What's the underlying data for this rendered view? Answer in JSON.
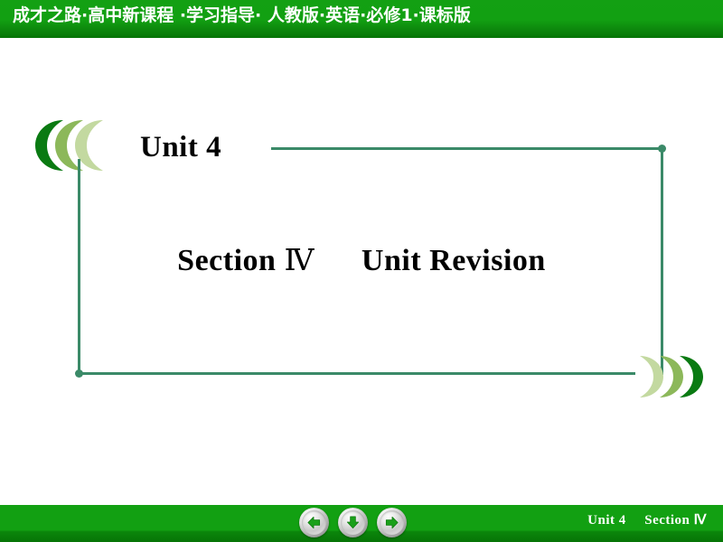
{
  "header": {
    "title": "成才之路·高中新课程 ·学习指导· 人教版·英语·必修1·课标版",
    "bg_color": "#12a012"
  },
  "slide": {
    "unit_label": "Unit 4",
    "title_prefix": "Section",
    "title_roman": "Ⅳ",
    "title_main": "Unit Revision",
    "frame_color": "#3b8a68"
  },
  "decorations": {
    "left_chevrons": {
      "name": "chevron-cluster-left",
      "colors": [
        "#0a7a12",
        "#8cb85a",
        "#c3d9a0"
      ]
    },
    "right_chevrons": {
      "name": "chevron-cluster-right",
      "colors": [
        "#c3d9a0",
        "#8cb85a",
        "#0a7a12"
      ]
    }
  },
  "footer": {
    "unit_label": "Unit 4",
    "section_label": "Section Ⅳ",
    "bg_color": "#12a012",
    "nav": [
      {
        "name": "previous-slide-button",
        "icon": "arrow-left-icon",
        "label": "Previous"
      },
      {
        "name": "down-slide-button",
        "icon": "arrow-down-icon",
        "label": "Down"
      },
      {
        "name": "next-slide-button",
        "icon": "arrow-right-icon",
        "label": "Next"
      }
    ]
  }
}
